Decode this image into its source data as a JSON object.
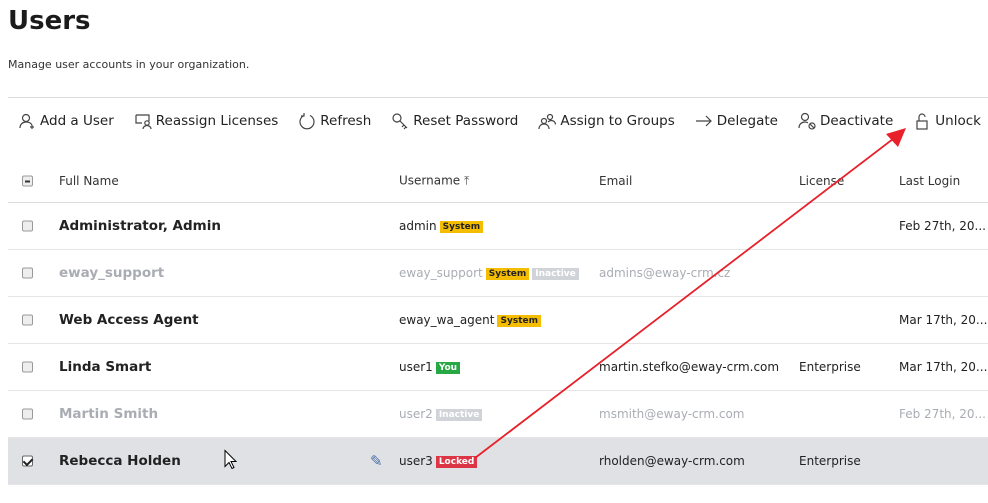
{
  "page": {
    "title": "Users",
    "subtitle": "Manage user accounts in your organization."
  },
  "toolbar": [
    {
      "label": "Add a User",
      "icon": "add-user-icon"
    },
    {
      "label": "Reassign Licenses",
      "icon": "reassign-licenses-icon"
    },
    {
      "label": "Refresh",
      "icon": "refresh-icon"
    },
    {
      "label": "Reset Password",
      "icon": "key-icon"
    },
    {
      "label": "Assign to Groups",
      "icon": "group-icon"
    },
    {
      "label": "Delegate",
      "icon": "arrow-right-icon"
    },
    {
      "label": "Deactivate",
      "icon": "user-block-icon"
    },
    {
      "label": "Unlock",
      "icon": "unlock-icon"
    }
  ],
  "columns": {
    "full_name": "Full Name",
    "username": "Username",
    "email": "Email",
    "license": "License",
    "last_login": "Last Login"
  },
  "rows": [
    {
      "name": "Administrator, Admin",
      "username": "admin",
      "badges": [
        "System"
      ],
      "email": "",
      "license": "",
      "last_login": "Feb 27th, 20...",
      "inactive": false,
      "selected": false
    },
    {
      "name": "eway_support",
      "username": "eway_support",
      "badges": [
        "System",
        "Inactive"
      ],
      "email": "admins@eway-crm.cz",
      "license": "",
      "last_login": "",
      "inactive": true,
      "selected": false
    },
    {
      "name": "Web Access Agent",
      "username": "eway_wa_agent",
      "badges": [
        "System"
      ],
      "email": "",
      "license": "",
      "last_login": "Mar 17th, 20...",
      "inactive": false,
      "selected": false
    },
    {
      "name": "Linda Smart",
      "username": "user1",
      "badges": [
        "You"
      ],
      "email": "martin.stefko@eway-crm.com",
      "license": "Enterprise",
      "last_login": "Mar 17th, 20...",
      "inactive": false,
      "selected": false
    },
    {
      "name": "Martin Smith",
      "username": "user2",
      "badges": [
        "Inactive"
      ],
      "email": "msmith@eway-crm.com",
      "license": "",
      "last_login": "Feb 27th, 20...",
      "inactive": true,
      "selected": false
    },
    {
      "name": "Rebecca Holden",
      "username": "user3",
      "badges": [
        "Locked"
      ],
      "email": "rholden@eway-crm.com",
      "license": "Enterprise",
      "last_login": "",
      "inactive": false,
      "selected": true
    }
  ],
  "colors": {
    "system": "#f5bd00",
    "inactive": "#d0d3d8",
    "you": "#28a745",
    "locked": "#dc3545",
    "annotation_arrow": "#e8202a",
    "selected_row": "#dfe1e5"
  }
}
